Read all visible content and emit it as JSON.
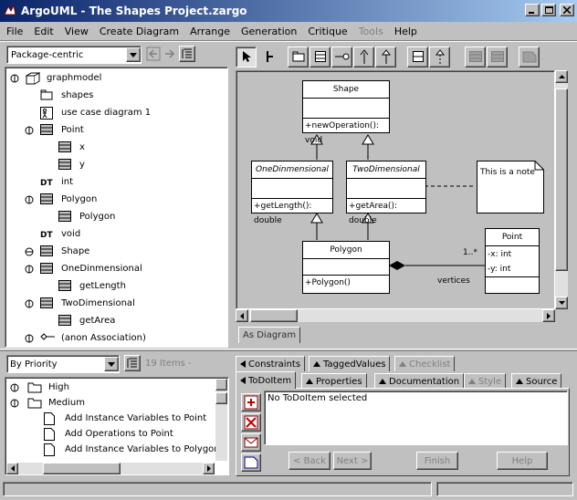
{
  "window": {
    "title": "ArgoUML - The Shapes Project.zargo"
  },
  "menu": [
    "File",
    "Edit",
    "View",
    "Create Diagram",
    "Arrange",
    "Generation",
    "Critique",
    "Tools",
    "Help"
  ],
  "nav": {
    "perspective": "Package-centric"
  },
  "tree": [
    {
      "label": "graphmodel",
      "indent": 0,
      "icon": "model-icon",
      "toggle": "minus"
    },
    {
      "label": "shapes",
      "indent": 1,
      "icon": "package-icon",
      "toggle": ""
    },
    {
      "label": "use case diagram 1",
      "indent": 1,
      "icon": "diagram-icon",
      "toggle": ""
    },
    {
      "label": "Point",
      "indent": 1,
      "icon": "class-icon",
      "toggle": "minus"
    },
    {
      "label": "x",
      "indent": 2,
      "icon": "attribute-icon",
      "toggle": ""
    },
    {
      "label": "y",
      "indent": 2,
      "icon": "attribute-icon",
      "toggle": ""
    },
    {
      "label": "int",
      "indent": 1,
      "icon": "datatype-icon",
      "toggle": ""
    },
    {
      "label": "Polygon",
      "indent": 1,
      "icon": "class-icon",
      "toggle": "minus"
    },
    {
      "label": "Polygon",
      "indent": 2,
      "icon": "attribute-icon",
      "toggle": ""
    },
    {
      "label": "void",
      "indent": 1,
      "icon": "datatype-icon",
      "toggle": ""
    },
    {
      "label": "Shape",
      "indent": 1,
      "icon": "class-icon",
      "toggle": "plus"
    },
    {
      "label": "OneDinmensional",
      "indent": 1,
      "icon": "class-icon",
      "toggle": "minus"
    },
    {
      "label": "getLength",
      "indent": 2,
      "icon": "attribute-icon",
      "toggle": ""
    },
    {
      "label": "TwoDimensional",
      "indent": 1,
      "icon": "class-icon",
      "toggle": "minus"
    },
    {
      "label": "getArea",
      "indent": 2,
      "icon": "attribute-icon",
      "toggle": ""
    },
    {
      "label": "(anon Association)",
      "indent": 1,
      "icon": "association-icon",
      "toggle": "minus"
    }
  ],
  "diagram": {
    "shape": {
      "name": "Shape",
      "op": "+newOperation(): void"
    },
    "one": {
      "name": "OneDinmensional",
      "op": "+getLength(): double"
    },
    "two": {
      "name": "TwoDimensional",
      "op": "+getArea(): double"
    },
    "note": "This is a note",
    "polygon": {
      "name": "Polygon",
      "op": "+Polygon()"
    },
    "point": {
      "name": "Point",
      "attrs": [
        "-x: int",
        "-y: int"
      ]
    },
    "multiplicity": "1..*",
    "role": "vertices"
  },
  "diagram_tab": "As Diagram",
  "todo": {
    "sort": "By Priority",
    "count": "19 Items -",
    "items": [
      {
        "label": "High",
        "type": "folder",
        "indent": 0
      },
      {
        "label": "Medium",
        "type": "folder",
        "indent": 0
      },
      {
        "label": "Add Instance Variables to Point",
        "type": "doc",
        "indent": 1
      },
      {
        "label": "Add Operations to Point",
        "type": "doc",
        "indent": 1
      },
      {
        "label": "Add Instance Variables to Polygon",
        "type": "doc",
        "indent": 1
      }
    ]
  },
  "details": {
    "tabs_top": [
      "Constraints",
      "TaggedValues",
      "Checklist"
    ],
    "tabs_bottom": [
      "ToDoItem",
      "Properties",
      "Documentation",
      "Style",
      "Source"
    ],
    "message": "No ToDoItem selected",
    "buttons": [
      "< Back",
      "Next >",
      "Finish",
      "Help"
    ]
  }
}
